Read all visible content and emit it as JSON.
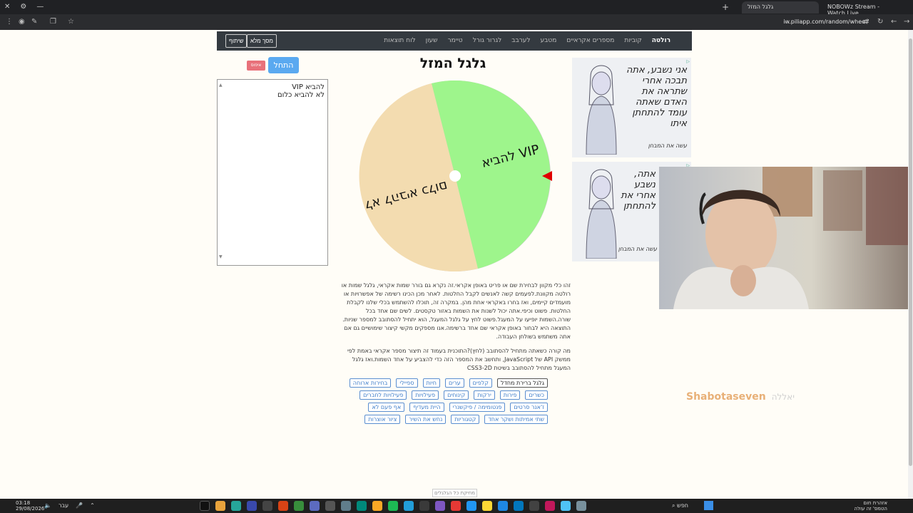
{
  "browser": {
    "tab_active_title": "גלגל המזל",
    "tab_other_title": "NOBOWz Stream - Watch Live",
    "url": "iw.piliapp.com/random/wheel/"
  },
  "nav": {
    "brand": "רולטה",
    "items": [
      "קוביות",
      "מספרים אקראיים",
      "מטבע",
      "לערבב",
      "לגרור גורל",
      "טיימר",
      "שעון",
      "לוח תוצאות"
    ],
    "fullscreen_label": "מסך מלא",
    "share_label": "שיתוף"
  },
  "wheel": {
    "title": "גלגל המזל",
    "start_label": "התחל",
    "reset_label": "איפוס",
    "segments": [
      {
        "label": "להביא VIP",
        "color": "#9ef58c"
      },
      {
        "label": "לא להביא כלום",
        "color": "#f3dcb0"
      }
    ],
    "pointer_color": "#e00000"
  },
  "entries": {
    "lines": [
      "להביא VIP",
      "לא להביא כלום"
    ]
  },
  "ad": {
    "text": "אני נשבע, אתה תבכה אחרי שתראה את האדם שאתה עומד להתחתן איתו",
    "text_short": "אתה, נשבע אחרי את להתחתן",
    "cta": "עשה את המבחן"
  },
  "description": {
    "p1": "זהו כלי מקוון לבחירת שם או פריט באופן אקראי.זה נקרא גם בורר שמות אקראי, גלגל שמות או רולטה מקוונת.לפעמים קשה לאנשים לקבל החלטות. לאחר מכן הכינו רשימה של אפשרויות או מועמדים קיימים, ואז בחרו באקראי אחת מהן. במקרה זה, תוכלו להשתמש בכלי שלנו לקבלת החלטות. פשוט וכיפי.אתה יכול לשנות את השמות באזור טקסטים. לשים שם אחד בכל שורה.השמות יופיעו על המעגל.פשוט לחץ על גלגל המעגל, הוא יתחיל להסתובב למספר שניות. התוצאה היא לבחור באופן אקראי שם אחד ברשימה.אנו מספקים מקשי קיצור שימושיים גם אם אתה משתמש בשולחן העבודה.",
    "p2": "מה קורה כשאתה מתחיל להסתובב (לחץ)?התוכנית בעמוד זה תיצור מספר אקראי באמת לפי ממשק API של JavaScript, ותחשב את המספר הזה כדי להצביע על אחד השמות.ואז גלגל המעגל מתחיל להסתובב בשיטת CSS3-2D"
  },
  "tags": [
    {
      "label": "גלגל ברירת מחדל",
      "active": true
    },
    {
      "label": "קלפים",
      "active": false
    },
    {
      "label": "ערים",
      "active": false
    },
    {
      "label": "חיות",
      "active": false
    },
    {
      "label": "ספיילי",
      "active": false
    },
    {
      "label": "בחירות ארוחה",
      "active": false
    },
    {
      "label": "כשרים",
      "active": false
    },
    {
      "label": "פירות",
      "active": false
    },
    {
      "label": "ירקות",
      "active": false
    },
    {
      "label": "קינוחים",
      "active": false
    },
    {
      "label": "פעילויות",
      "active": false
    },
    {
      "label": "פעילויות לחברים",
      "active": false
    },
    {
      "label": "ז'אנר סרטים",
      "active": false
    },
    {
      "label": "פנטומימה / פיקשנרי",
      "active": false
    },
    {
      "label": "היית מעדיף",
      "active": false
    },
    {
      "label": "אף פעם לא",
      "active": false
    },
    {
      "label": "שתי אמיתות ושקר אחד",
      "active": false
    },
    {
      "label": "קטגוריות",
      "active": false
    },
    {
      "label": "נחש את השיר",
      "active": false
    },
    {
      "label": "ציור אוצרות",
      "active": false
    }
  ],
  "footer_link": "מחיקת כל הגלגלים",
  "watermark": {
    "name": "Shabotaseven",
    "hebrew": "יאללה"
  },
  "taskbar": {
    "time": "03:18",
    "date": "29/08/2026",
    "lang": "עבר",
    "search_label": "חפש",
    "weather_title": "אזהרת חום",
    "weather_sub": "הטמפ' זה עולה"
  }
}
